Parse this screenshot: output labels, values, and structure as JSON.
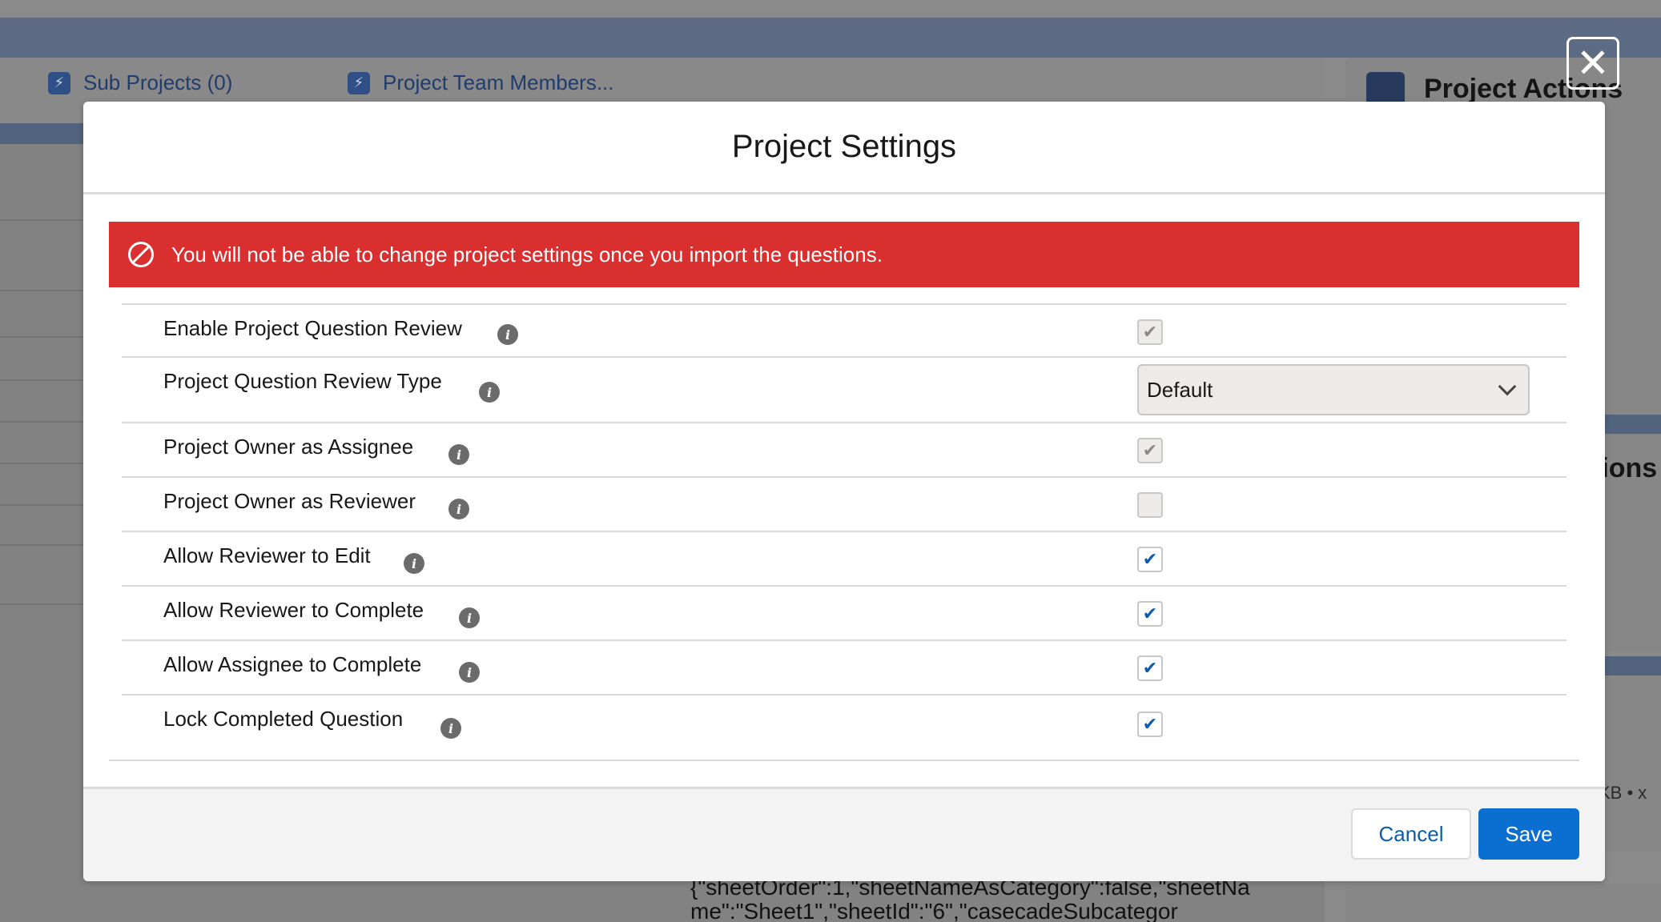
{
  "background": {
    "tabs": [
      {
        "label": "Sub Projects (0)"
      },
      {
        "label": "Project Team Members..."
      }
    ],
    "right_panel_title": "Project Actions",
    "right_panel_partial": "tions",
    "right_panel_meta": "KB • x",
    "json_snippet": "{\"sheetOrder\":1,\"sheetNameAsCategory\":false,\"sheetName\":\"Sheet1\",\"sheetId\":\"6\",\"casecadeSubcategor"
  },
  "close_label": "✕",
  "modal": {
    "title": "Project Settings",
    "alert_text": "You will not be able to change project settings once you import the questions.",
    "settings": [
      {
        "label": "Enable Project Question Review",
        "type": "checkbox",
        "checked": true,
        "disabled": true
      },
      {
        "label": "Project Question Review Type",
        "type": "select",
        "value": "Default"
      },
      {
        "label": "Project Owner as Assignee",
        "type": "checkbox",
        "checked": true,
        "disabled": true
      },
      {
        "label": "Project Owner as Reviewer",
        "type": "checkbox",
        "checked": false,
        "disabled": true
      },
      {
        "label": "Allow Reviewer to Edit",
        "type": "checkbox",
        "checked": true,
        "disabled": false
      },
      {
        "label": "Allow Reviewer to Complete",
        "type": "checkbox",
        "checked": true,
        "disabled": false
      },
      {
        "label": "Allow Assignee to Complete",
        "type": "checkbox",
        "checked": true,
        "disabled": false
      },
      {
        "label": "Lock Completed Question",
        "type": "checkbox",
        "checked": true,
        "disabled": false
      }
    ],
    "info_glyph": "i",
    "check_glyph": "✔",
    "cancel_label": "Cancel",
    "save_label": "Save"
  },
  "colors": {
    "alert": "#d92f2f",
    "brand": "#0b6ed1",
    "link": "#0b5cab"
  }
}
